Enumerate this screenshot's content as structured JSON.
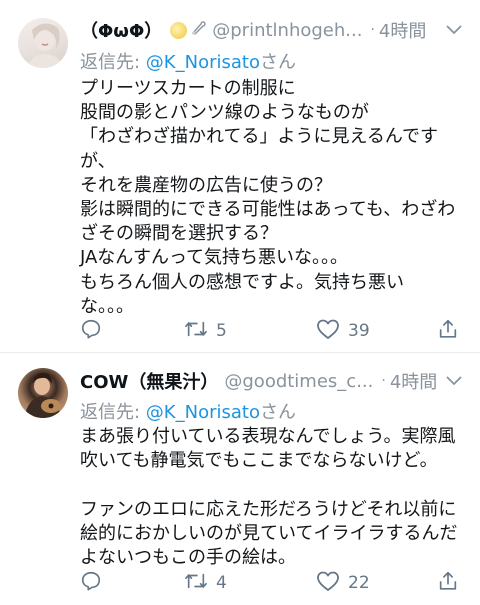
{
  "tweets": [
    {
      "display_name": "（ΦωΦ）",
      "handle": "@printlnhogeh...",
      "separator": "·",
      "time": "4時間",
      "reply_prefix": "返信先: ",
      "reply_to": "@K_Norisato",
      "reply_suffix": "さん",
      "lines": [
        "プリーツスカートの制服に",
        "股間の影とパンツ線のようなものが",
        "「わざわざ描かれてる」ように見えるんです",
        "が、",
        "それを農産物の広告に使うの？",
        "影は瞬間的にできる可能性はあっても、わざわ",
        "ざその瞬間を選択する？",
        "JAなんすんって気持ち悪いな。。。",
        "もちろん個人の感想ですよ。気持ち悪い",
        "な。。。"
      ],
      "reply_count": "",
      "retweet_count": "5",
      "like_count": "39"
    },
    {
      "display_name": "COW（無果汁）",
      "handle": "@goodtimes_c...",
      "separator": "·",
      "time": "4時間",
      "reply_prefix": "返信先: ",
      "reply_to": "@K_Norisato",
      "reply_suffix": "さん",
      "lines": [
        "まあ張り付いている表現なんでしょう。実際風",
        "吹いても静電気でもここまでならないけど。",
        "",
        "ファンのエロに応えた形だろうけどそれ以前に",
        "絵的におかしいのが見ていてイライラするんだ",
        "よないつもこの手の絵は。"
      ],
      "reply_count": "",
      "retweet_count": "4",
      "like_count": "22"
    }
  ],
  "icons": {
    "emoji_1": "full-moon-emoji",
    "emoji_2": "safety-pin-emoji",
    "chevron": "chevron-down-icon",
    "reply": "reply-icon",
    "retweet": "retweet-icon",
    "like": "heart-icon",
    "share": "share-icon"
  },
  "colors": {
    "link": "#1b95e0",
    "meta": "#8a939c",
    "action": "#657786",
    "divider": "#e6ecf0"
  }
}
